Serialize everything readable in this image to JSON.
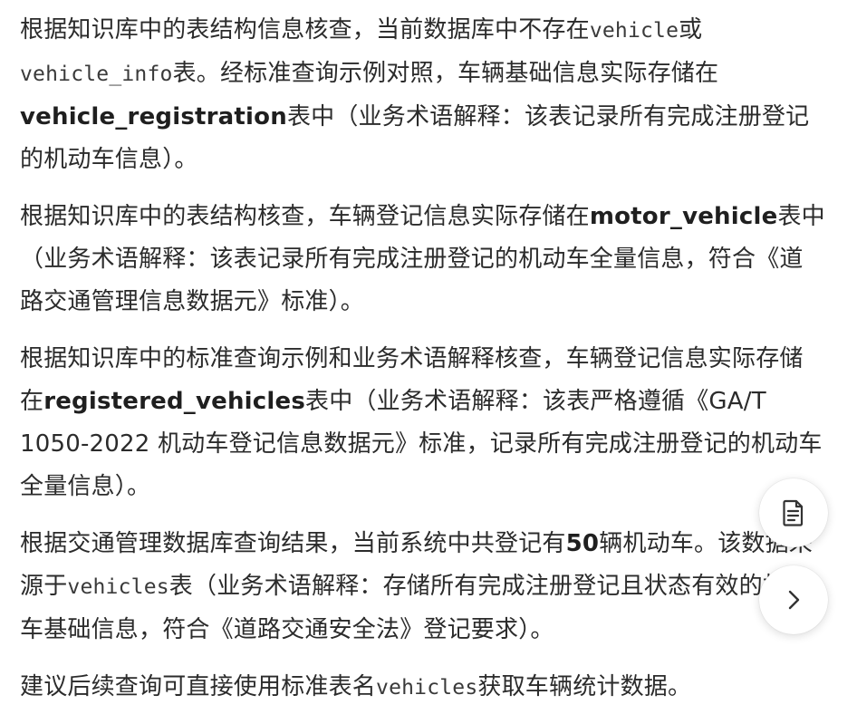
{
  "paragraphs": [
    {
      "p1_a": "根据知识库中的表结构信息核查，当前数据库中不存在",
      "p1_code1": "vehicle",
      "p1_b": "或",
      "p1_code2": "vehicle_info",
      "p1_c": "表。经标准查询示例对照，车辆基础信息实际存储在",
      "p1_bold": "vehicle_registration",
      "p1_d": "表中（业务术语解释：该表记录所有完成注册登记的机动车信息）。"
    },
    {
      "p2_a": "根据知识库中的表结构核查，车辆登记信息实际存储在",
      "p2_bold": "motor_vehicle",
      "p2_b": "表中（业务术语解释：该表记录所有完成注册登记的机动车全量信息，符合《道路交通管理信息数据元》标准）。"
    },
    {
      "p3_a": "根据知识库中的标准查询示例和业务术语解释核查，车辆登记信息实际存储在",
      "p3_bold": "registered_vehicles",
      "p3_b": "表中（业务术语解释：该表严格遵循《GA/T 1050-2022 机动车登记信息数据元》标准，记录所有完成注册登记的机动车全量信息）。"
    },
    {
      "p4_a": "根据交通管理数据库查询结果，当前系统中共登记有",
      "p4_bold": "50",
      "p4_b": "辆机动车。该数据来源于",
      "p4_code": "vehicles",
      "p4_c": "表（业务术语解释：存储所有完成注册登记且状态有效的机动车基础信息，符合《道路交通安全法》登记要求）。"
    },
    {
      "p5_a": "建议后续查询可直接使用标准表名",
      "p5_code": "vehicles",
      "p5_b": "获取车辆统计数据。"
    }
  ],
  "floating_buttons": {
    "doc_icon": "document-icon",
    "next_icon": "chevron-right-icon"
  },
  "colors": {
    "text": "#2b2b2b",
    "background": "#ffffff"
  }
}
